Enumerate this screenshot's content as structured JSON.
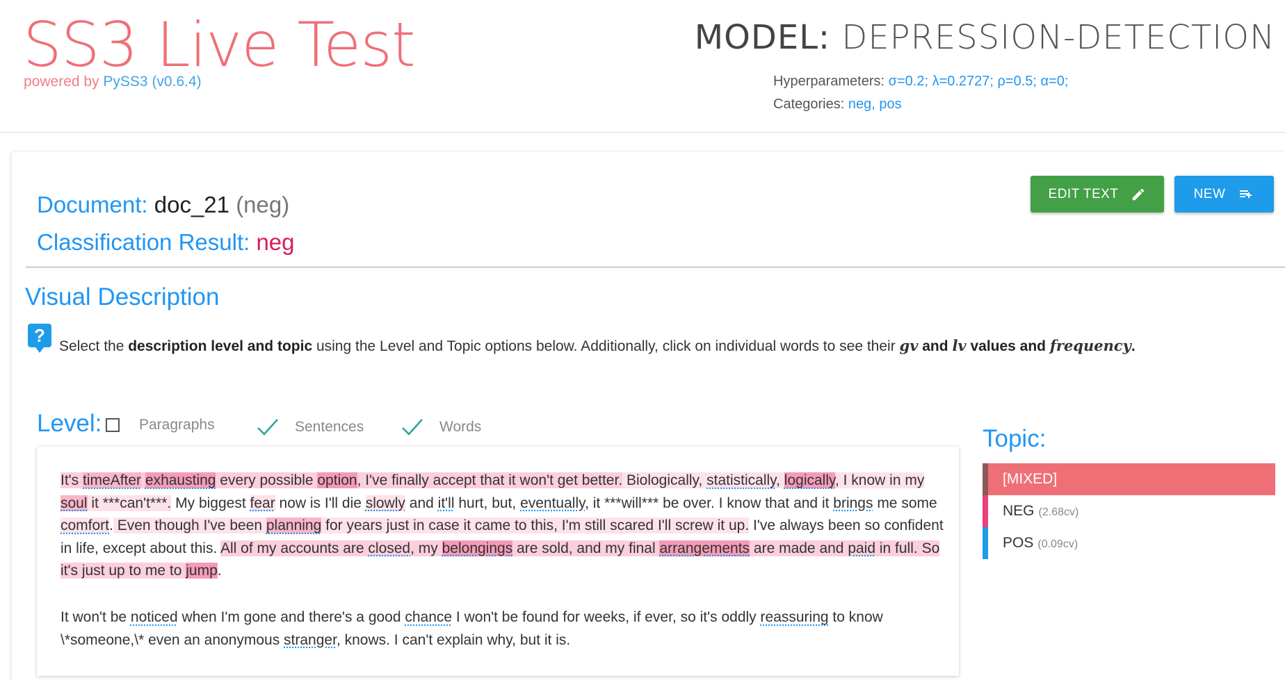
{
  "header": {
    "app_title": "SS3 Live Test",
    "powered_prefix": "powered by ",
    "powered_lib": "PySS3 (v0.6.4)",
    "model_prefix": "MODEL: ",
    "model_name": "DEPRESSION-DETECTION",
    "hyper_label": "Hyperparameters: ",
    "hyper_values": "σ=0.2; λ=0.2727; ρ=0.5; α=0;",
    "categories_label": "Categories: ",
    "categories_values": "neg, pos"
  },
  "document": {
    "doc_label": "Document: ",
    "doc_name": "doc_21",
    "doc_true": "(neg)",
    "result_label": "Classification Result: ",
    "result_value": "neg"
  },
  "buttons": {
    "edit_label": "EDIT TEXT",
    "new_label": "NEW"
  },
  "visual": {
    "title": "Visual Description",
    "help_icon": "?",
    "help_1": "Select the ",
    "help_2": "description level and topic",
    "help_3": " using the Level and Topic options below. Additionally, click on individual words to see their ",
    "help_gv": "gv",
    "help_and": " and ",
    "help_lv": "lv",
    "help_values": " values and ",
    "help_freq": "frequency",
    "help_end": "."
  },
  "level": {
    "label": "Level:",
    "options": [
      {
        "label": "Paragraphs",
        "checked": false
      },
      {
        "label": "Sentences",
        "checked": true
      },
      {
        "label": "Words",
        "checked": true
      }
    ]
  },
  "topic": {
    "label": "Topic:",
    "items": [
      {
        "label": "[MIXED]",
        "cv": "",
        "active": true
      },
      {
        "label": "NEG",
        "cv": "(2.68cv)",
        "active": false
      },
      {
        "label": "POS",
        "cv": "(0.09cv)",
        "active": false
      }
    ]
  },
  "text": {
    "p1": [
      "It's ",
      "timeAfter",
      " ",
      "exhausting",
      " every possible ",
      "option",
      ", I've finally accept that it won't get better.",
      " Biologically, ",
      "statistically",
      ", ",
      "logically",
      ", I know in my ",
      "soul",
      " it ***can't***.",
      " My biggest ",
      "fear",
      " now is I'll die ",
      "slowly",
      " and ",
      "it'll",
      " hurt, but, ",
      "eventually",
      ", it ***will*** be over.",
      " I know that and it ",
      "brings",
      " me some ",
      "comfort",
      ".",
      " Even though I've been ",
      "planning",
      " for years just in case it came to this, I'm still scared I'll screw it up.",
      " I've always been so confident in life, except about this. ",
      "All of my accounts are ",
      "closed",
      ", my ",
      "belongings",
      " are sold, and my final ",
      "arrangements",
      " are made and ",
      "paid",
      " in full.",
      " So it's just up to me to ",
      "jump",
      "."
    ],
    "p2": [
      "It won't be ",
      "noticed",
      " when I'm gone and there's a good ",
      "chance",
      " I won't be found for weeks, if ever, so it's oddly ",
      "reassuring",
      " to know \\*someone,\\* even an anonymous ",
      "stranger",
      ", knows. I can't explain why, but it is."
    ]
  }
}
